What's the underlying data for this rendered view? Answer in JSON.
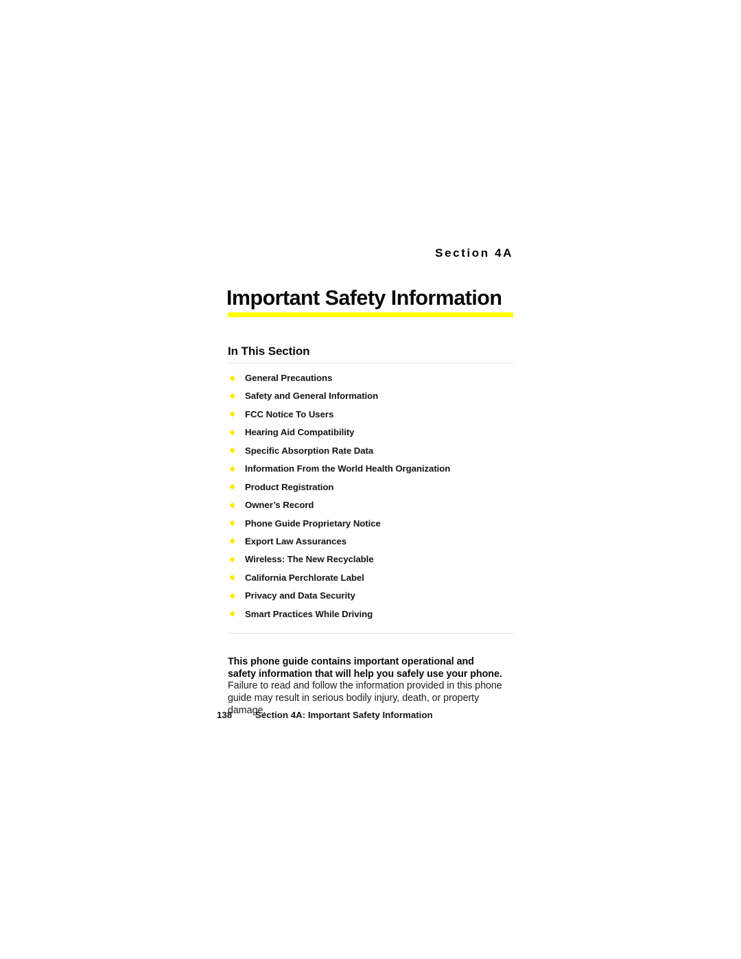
{
  "page": {
    "background_color": "#FFFFFF",
    "accent_color": "#FFFF00",
    "bullet_color": "#FFE800",
    "rule_color": "#E4E4E4"
  },
  "header": {
    "section_label": "Section 4A",
    "title": "Important Safety Information"
  },
  "in_this_section": {
    "heading": "In This Section",
    "items": [
      {
        "label": "General Precautions"
      },
      {
        "label": "Safety and General Information"
      },
      {
        "label": "FCC Notice To Users"
      },
      {
        "label": "Hearing Aid Compatibility"
      },
      {
        "label": "Specific Absorption Rate Data"
      },
      {
        "label": "Information From the World Health Organization"
      },
      {
        "label": "Product Registration"
      },
      {
        "label": "Owner’s Record"
      },
      {
        "label": "Phone Guide Proprietary Notice"
      },
      {
        "label": "Export Law Assurances"
      },
      {
        "label": "Wireless: The New Recyclable"
      },
      {
        "label": "California Perchlorate Label"
      },
      {
        "label": "Privacy and Data Security"
      },
      {
        "label": "Smart Practices While Driving"
      }
    ]
  },
  "lead_paragraph": {
    "bold_text": "This phone guide contains important operational and safety information that will help you safely use your phone.",
    "normal_text": " Failure to read and follow the information provided in this phone guide may result in serious bodily injury, death, or property damage."
  },
  "footer": {
    "page_number": "138",
    "title": "Section 4A: Important Safety Information"
  }
}
